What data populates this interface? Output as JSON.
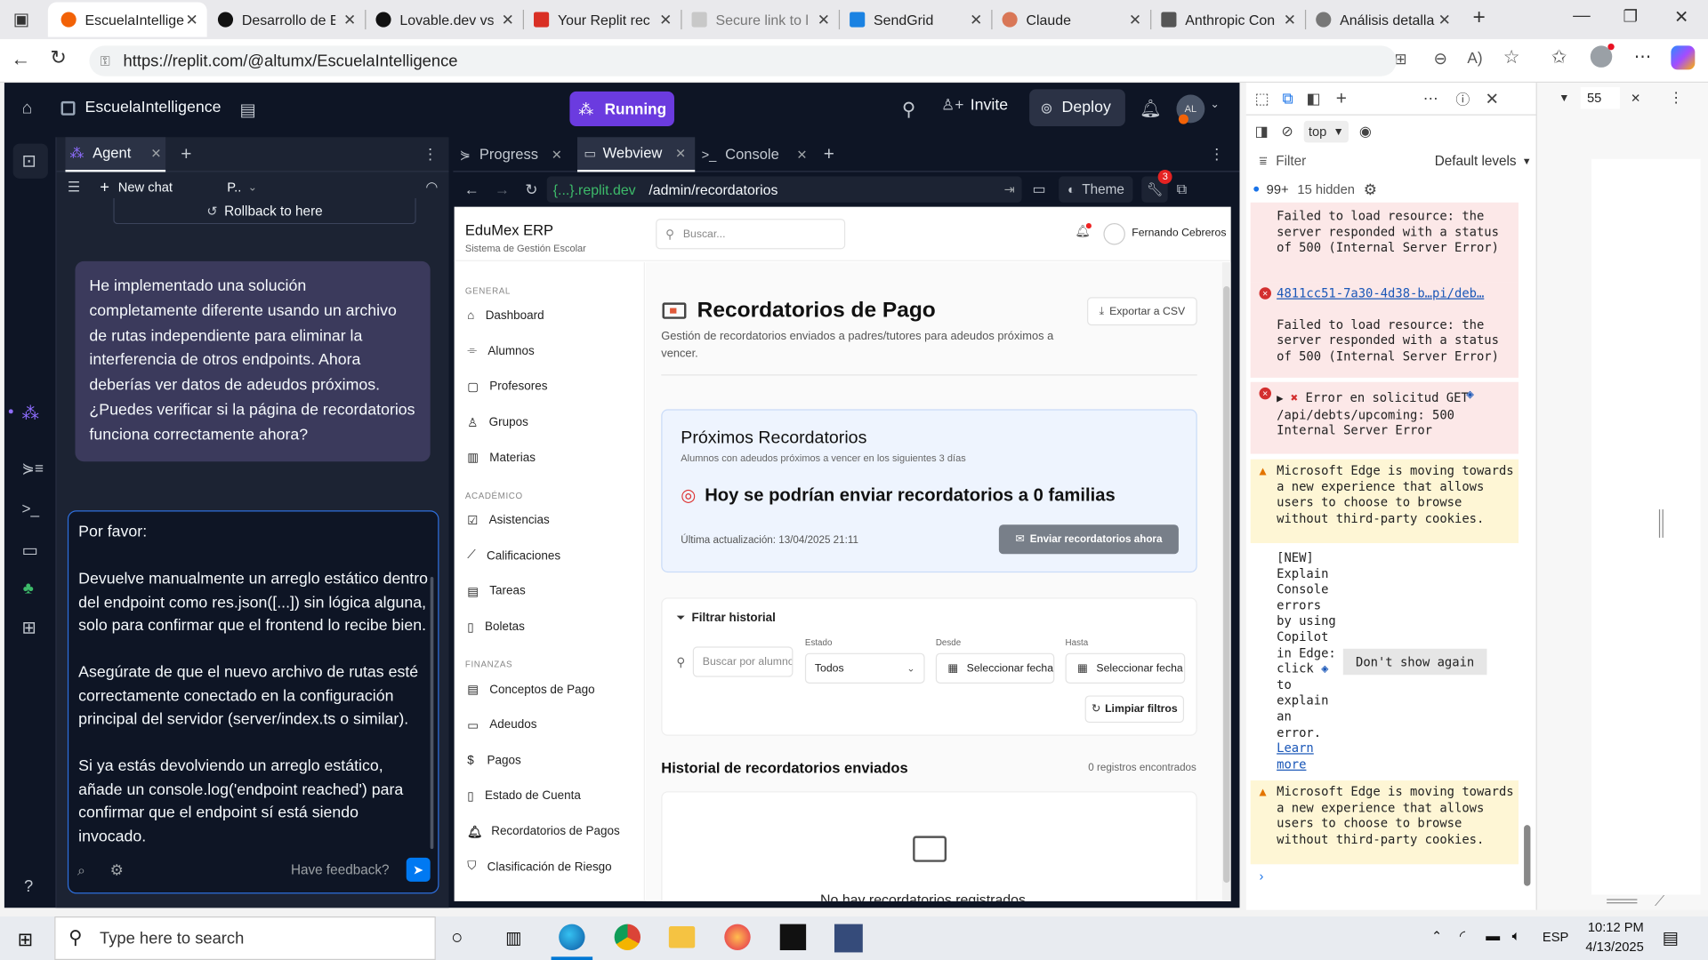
{
  "browser": {
    "tabs": [
      {
        "label": "EscuelaIntellige",
        "color": "#f26207"
      },
      {
        "label": "Desarrollo de E",
        "color": "#111111"
      },
      {
        "label": "Lovable.dev vs",
        "color": "#111111"
      },
      {
        "label": "Your Replit rec",
        "color": "#d93025"
      },
      {
        "label": "Secure link to l",
        "color": "#d0d0d0"
      },
      {
        "label": "SendGrid",
        "color": "#1a82e2"
      },
      {
        "label": "Claude",
        "color": "#d97757"
      },
      {
        "label": "Anthropic Con",
        "color": "#555555"
      },
      {
        "label": "Análisis detalla",
        "color": "#777777"
      }
    ],
    "url": "https://replit.com/@altumx/EscuelaIntelligence"
  },
  "replit": {
    "project": "EscuelaIntelligence",
    "status": "Running",
    "invite": "Invite",
    "deploy": "Deploy",
    "avatar": "AL",
    "agent_tab": "Agent",
    "new_chat": "New chat",
    "chat_dropdown": "P..",
    "rollback": "Rollback to here",
    "agent_message": "He implementado una solución completamente diferente usando un archivo de rutas independiente para eliminar la interferencia de otros endpoints. Ahora deberías ver datos de adeudos próximos. ¿Puedes verificar si la página de recordatorios funciona correctamente ahora?",
    "input": {
      "p1": "Por favor:",
      "p2": "Devuelve manualmente un arreglo estático dentro del endpoint como res.json([...]) sin lógica alguna, solo para confirmar que el frontend lo recibe bien.",
      "p3": "Asegúrate de que el nuevo archivo de rutas esté correctamente conectado en la configuración principal del servidor (server/index.ts o similar).",
      "p4": "Si ya estás devolviendo un arreglo estático, añade un console.log('endpoint reached') para confirmar que el endpoint sí está siendo invocado."
    },
    "feedback": "Have feedback?",
    "pane_tabs": [
      "Progress",
      "Webview",
      "Console"
    ],
    "web_host": "{...}.replit.dev",
    "web_path": "/admin/recordatorios",
    "theme": "Theme",
    "badge": "3"
  },
  "app": {
    "brand": "EduMex ERP",
    "brand_sub": "Sistema de Gestión Escolar",
    "search_placeholder": "Buscar...",
    "user": "Fernando Cebreros",
    "groups": [
      {
        "title": "GENERAL",
        "items": [
          "Dashboard",
          "Alumnos",
          "Profesores",
          "Grupos",
          "Materias"
        ]
      },
      {
        "title": "ACADÉMICO",
        "items": [
          "Asistencias",
          "Calificaciones",
          "Tareas",
          "Boletas"
        ]
      },
      {
        "title": "FINANZAS",
        "items": [
          "Conceptos de Pago",
          "Adeudos",
          "Pagos",
          "Estado de Cuenta",
          "Recordatorios de Pagos",
          "Clasificación de Riesgo"
        ]
      }
    ],
    "title": "Recordatorios de Pago",
    "subtitle": "Gestión de recordatorios enviados a padres/tutores para adeudos próximos a vencer.",
    "export": "Exportar a CSV",
    "upcoming_title": "Próximos Recordatorios",
    "upcoming_sub": "Alumnos con adeudos próximos a vencer en los siguientes 3 días",
    "upcoming_main": "Hoy se podrían enviar recordatorios a 0 familias",
    "updated": "Última actualización: 13/04/2025 21:11",
    "send": "Enviar recordatorios ahora",
    "filter_title": "Filtrar historial",
    "search_student": "Buscar por alumno",
    "estado_label": "Estado",
    "estado_value": "Todos",
    "desde_label": "Desde",
    "hasta_label": "Hasta",
    "select_date": "Seleccionar fecha",
    "clear": "Limpiar filtros",
    "history_title": "Historial de recordatorios enviados",
    "history_count": "0 registros encontrados",
    "empty": "No hay recordatorios registrados"
  },
  "devtools": {
    "context": "top",
    "filter": "Filter",
    "levels": "Default levels",
    "count": "99+",
    "hidden": "15 hidden",
    "zoom": "55",
    "m1": "Failed to load resource: the server responded with a status of 500 (Internal Server Error)",
    "link": "4811cc51-7a30-4d38-b…pi/deb…",
    "m2": "Failed to load resource: the server responded with a status of 500 (Internal Server Error)",
    "m3": "Error en solicitud GET /api/debts/upcoming: 500 Internal Server Error",
    "w1": "Microsoft Edge is moving towards a new experience that allows users to choose to browse without third-party cookies.",
    "info": "[NEW] Explain Console errors by using Copilot in Edge: click",
    "info2": "to explain an error.",
    "learn": "Learn more",
    "dont": "Don't show again",
    "w2": "Microsoft Edge is moving towards a new experience that allows users to choose to browse without third-party cookies."
  },
  "taskbar": {
    "search": "Type here to search",
    "lang": "ESP",
    "time": "10:12 PM",
    "date": "4/13/2025"
  }
}
